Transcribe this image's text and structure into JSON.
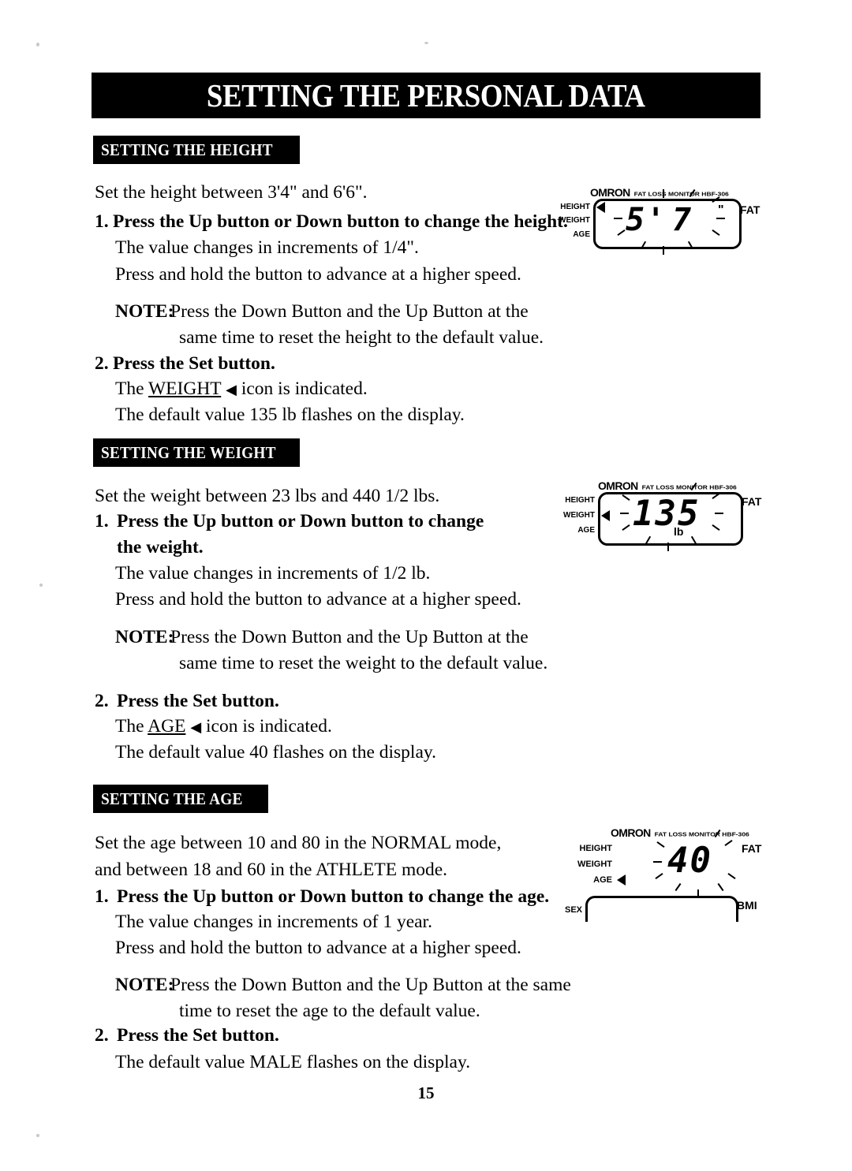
{
  "document": {
    "title": "SETTING THE PERSONAL DATA",
    "page_number": "15"
  },
  "sections": [
    {
      "header": "SETTING THE HEIGHT",
      "intro": "Set the height between 3'4\" and 6'6\".",
      "step1_number": "1.",
      "step1_text": "Press the Up button or Down button to change the height.",
      "step1_detail_1": "The value changes in increments of 1/4\".",
      "step1_detail_2": "Press and hold the button to advance at a higher speed.",
      "note_label": "NOTE:",
      "note_line_1": "Press the Down Button and the Up Button at the",
      "note_line_2": "same time to reset the height to the default value.",
      "step2_number": "2.",
      "step2_text": "Press the Set button.",
      "step2_detail_1_pre": "The",
      "step2_detail_1_target": "WEIGHT",
      "step2_detail_1_post": "icon is indicated.",
      "step2_detail_2": "The default value 135 lb flashes on the display."
    },
    {
      "header": "SETTING THE WEIGHT",
      "intro": "Set the weight between 23 lbs and 440 1/2 lbs.",
      "step1_number": "1.",
      "step1_text_line_1": "Press the Up button or Down button to change",
      "step1_text_line_2": "the weight.",
      "step1_detail_1": "The value changes in increments of 1/2 lb.",
      "step1_detail_2": "Press and hold the button to advance at a higher speed.",
      "note_label": "NOTE:",
      "note_line_1": "Press the Down Button and the Up Button at the",
      "note_line_2": "same time to reset the weight to the default value.",
      "step2_number": "2.",
      "step2_text": "Press the Set button.",
      "step2_detail_1_pre": "The",
      "step2_detail_1_target": "AGE",
      "step2_detail_1_post": "icon is indicated.",
      "step2_detail_2": "The default value 40 flashes on the display."
    },
    {
      "header": "SETTING THE AGE",
      "intro_line_1": "Set the age between 10 and 80 in the NORMAL mode,",
      "intro_line_2": "and between 18 and 60 in the ATHLETE mode.",
      "step1_number": "1.",
      "step1_text": "Press the Up button or Down button to change the age.",
      "step1_detail_1": "The value changes in increments of 1 year.",
      "step1_detail_2": "Press and hold the button to advance at a higher speed.",
      "note_label": "NOTE:",
      "note_line_1": "Press the Down Button and the Up Button at the same",
      "note_line_2": "time to reset the age to the default value.",
      "step2_number": "2.",
      "step2_text": "Press the Set button.",
      "step2_detail_1": "The default value MALE flashes on the display."
    }
  ],
  "devices": [
    {
      "brand": "OMRON",
      "model": "FAT LOSS MONITOR HBF-306",
      "labels": [
        "HEIGHT",
        "WEIGHT",
        "AGE"
      ],
      "active_label": "HEIGHT",
      "right_label": "FAT",
      "value": "5'",
      "value_2": "7",
      "unit": "\"",
      "marker_icon": "left-triangle-icon"
    },
    {
      "brand": "OMRON",
      "model": "FAT LOSS MONITOR HBF-306",
      "labels": [
        "HEIGHT",
        "WEIGHT",
        "AGE"
      ],
      "active_label": "WEIGHT",
      "right_label": "FAT",
      "value": "135",
      "unit": "lb",
      "marker_icon": "left-triangle-icon"
    },
    {
      "brand": "OMRON",
      "model": "FAT LOSS MONITOR HBF-306",
      "labels": [
        "HEIGHT",
        "WEIGHT",
        "AGE"
      ],
      "active_label": "AGE",
      "right_label": "FAT",
      "bmi_label": "BMI",
      "sex_label": "SEX",
      "value": "40",
      "marker_icon": "left-triangle-icon"
    }
  ],
  "colors": {
    "ink": "#000000",
    "paper": "#ffffff"
  }
}
